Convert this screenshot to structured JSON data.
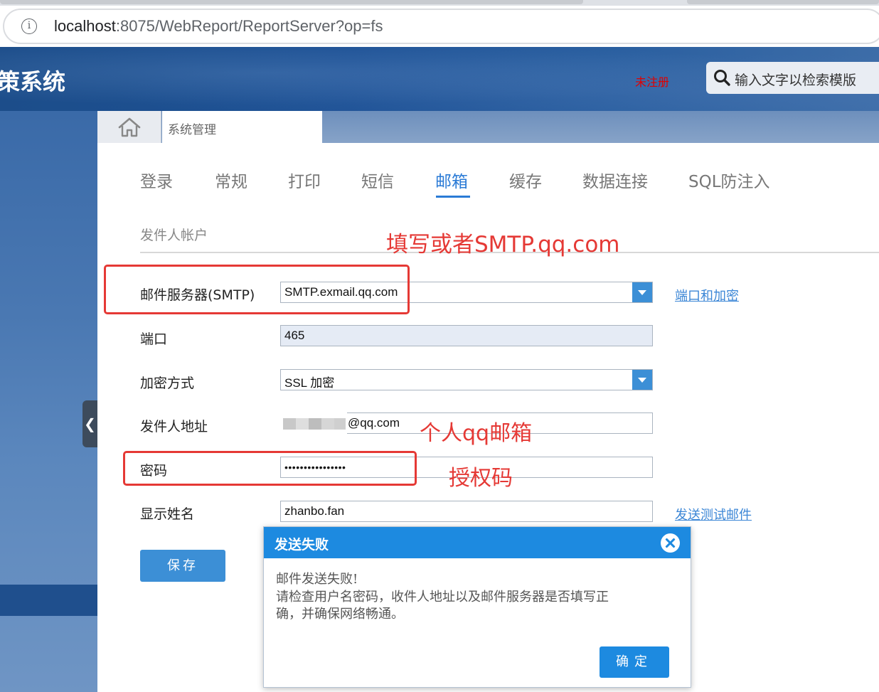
{
  "browser": {
    "url_host": "localhost",
    "url_rest": ":8075/WebReport/ReportServer?op=fs"
  },
  "header": {
    "app_title": "策系统",
    "unregistered": "未注册",
    "search_placeholder": "输入文字以检索模版"
  },
  "tabs": {
    "home_icon": "home-icon",
    "system_tab": "系统管理"
  },
  "nav": {
    "items": [
      "登录",
      "常规",
      "打印",
      "短信",
      "邮箱",
      "缓存",
      "数据连接",
      "SQL防注入"
    ],
    "active": "邮箱"
  },
  "form": {
    "section_title": "发件人帐户",
    "smtp_label": "邮件服务器(SMTP)",
    "smtp_value": "SMTP.exmail.qq.com",
    "port_label": "端口",
    "port_value": "465",
    "encryption_label": "加密方式",
    "encryption_value": "SSL 加密",
    "sender_label": "发件人地址",
    "sender_value": "@qq.com",
    "password_label": "密码",
    "password_value": "••••••••••••••••",
    "display_name_label": "显示姓名",
    "display_name_value": "zhanbo.fan",
    "port_encrypt_link": "端口和加密",
    "send_test_link": "发送测试邮件",
    "save_button": "保存"
  },
  "annotations": {
    "smtp_hint": "填写或者SMTP.qq.com",
    "sender_hint": "个人qq邮箱",
    "password_hint": "授权码"
  },
  "dialog": {
    "title": "发送失败",
    "line1": "邮件发送失败!",
    "line2": "请检查用户名密码，收件人地址以及邮件服务器是否填写正",
    "line3": "确，并确保网络畅通。",
    "ok_button": "确定"
  },
  "colors": {
    "accent": "#2b7bd6",
    "dialog_header": "#1d8ae0",
    "annotation": "#e53935",
    "unregistered": "#e00000"
  }
}
